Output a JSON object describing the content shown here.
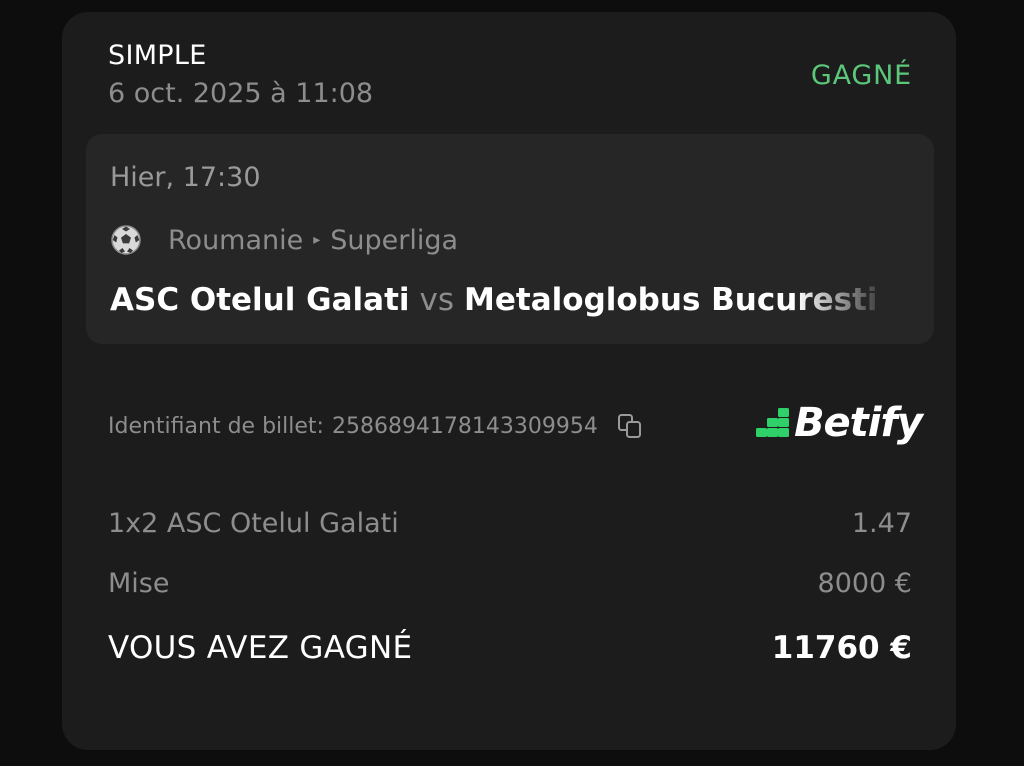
{
  "header": {
    "bet_type": "SIMPLE",
    "date": "6 oct. 2025 à 11:08",
    "status": "GAGNÉ"
  },
  "colors": {
    "status": "#5cc77a",
    "brand_accent": "#2fd06a",
    "card_bg": "#1c1c1c",
    "event_bg": "#262626"
  },
  "event": {
    "time": "Hier, 17:30",
    "sport_icon": "soccer-ball-icon",
    "country": "Roumanie",
    "league": "Superliga",
    "home_team": "ASC Otelul Galati",
    "vs": "vs",
    "away_team": "Metaloglobus Bucuresti"
  },
  "ticket": {
    "label": "Identifiant de billet:",
    "id": "2586894178143309954",
    "copy_icon": "copy-icon"
  },
  "brand": {
    "name": "Betify"
  },
  "summary": {
    "selection_label": "1x2 ASC Otelul Galati",
    "odds": "1.47",
    "stake_label": "Mise",
    "stake_value": "8000 €",
    "win_label": "VOUS AVEZ GAGNÉ",
    "win_value": "11760 €"
  }
}
